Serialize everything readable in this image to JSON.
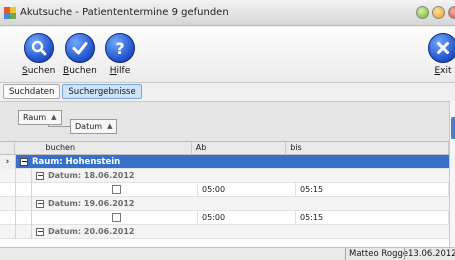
{
  "window": {
    "title": "Akutsuche - Patiententermine 9 gefunden"
  },
  "toolbar": {
    "suchen_mnemonic": "S",
    "suchen_rest": "uchen",
    "buchen_mnemonic": "B",
    "buchen_rest": "uchen",
    "hilfe_mnemonic": "H",
    "hilfe_rest": "ilfe",
    "exit_mnemonic": "E",
    "exit_rest": "xit"
  },
  "tabs": [
    {
      "label": "Suchdaten",
      "active": false
    },
    {
      "label": "Suchergebnisse",
      "active": true
    }
  ],
  "grouping": {
    "chip1": "Raum",
    "chip2": "Datum"
  },
  "grid": {
    "columns": [
      "buchen",
      "Ab",
      "bis"
    ],
    "room_group": "Raum: Hohenstein",
    "date_groups": [
      {
        "label": "Datum: 18.06.2012",
        "rows": [
          {
            "ab": "05:00",
            "bis": "05:15"
          }
        ]
      },
      {
        "label": "Datum: 19.06.2012",
        "rows": [
          {
            "ab": "05:00",
            "bis": "05:15"
          }
        ]
      },
      {
        "label": "Datum: 20.06.2012",
        "rows": []
      }
    ]
  },
  "status": {
    "user": "Matteo Rogge",
    "date": "13.06.2012"
  },
  "icons": {
    "suchen": "search-icon",
    "buchen": "check-icon",
    "hilfe": "help-icon",
    "exit": "close-icon"
  }
}
